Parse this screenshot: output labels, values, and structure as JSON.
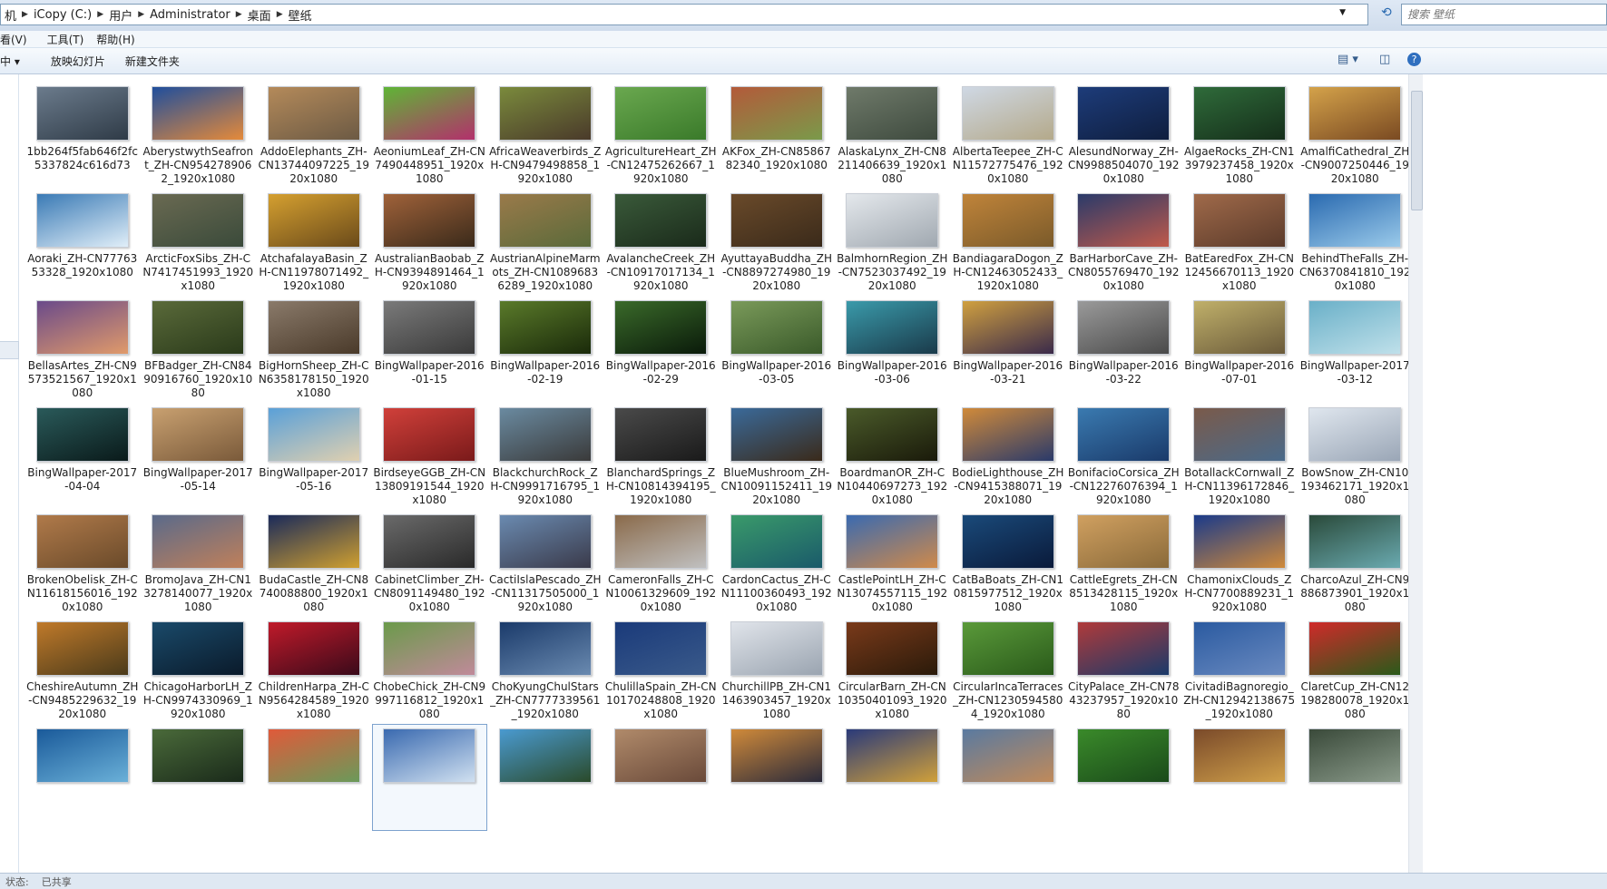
{
  "address": {
    "crumbs": [
      "机",
      "iCopy (C:)",
      "用户",
      "Administrator",
      "桌面",
      "壁纸"
    ]
  },
  "search": {
    "placeholder": "搜索 壁纸"
  },
  "menu": [
    "看(V)",
    "工具(T)",
    "帮助(H)"
  ],
  "toolbar": {
    "organize": "中 ▾",
    "slideshow": "放映幻灯片",
    "new_folder": "新建文件夹"
  },
  "status": {
    "left": "状态:",
    "right": "已共享"
  },
  "files": [
    {
      "name": "1bb264f5fab646f2fc5337824c616d73",
      "colors": [
        "#6b7b8c",
        "#2f3b47"
      ]
    },
    {
      "name": "AberystwythSeafront_ZH-CN9542789062_1920x1080",
      "colors": [
        "#1f4e9c",
        "#e58a3a"
      ]
    },
    {
      "name": "AddoElephants_ZH-CN13744097225_1920x1080",
      "colors": [
        "#b48a5a",
        "#6c5a44"
      ]
    },
    {
      "name": "AeoniumLeaf_ZH-CN7490448951_1920x1080",
      "colors": [
        "#5fb536",
        "#b3306c"
      ]
    },
    {
      "name": "AfricaWeaverbirds_ZH-CN9479498858_1920x1080",
      "colors": [
        "#7a8a3c",
        "#4a3a2a"
      ]
    },
    {
      "name": "AgricultureHeart_ZH-CN12475262667_1920x1080",
      "colors": [
        "#6aa84f",
        "#3a7a2a"
      ]
    },
    {
      "name": "AKFox_ZH-CN8586782340_1920x1080",
      "colors": [
        "#b35a3a",
        "#7a9a4a"
      ]
    },
    {
      "name": "AlaskaLynx_ZH-CN8211406639_1920x1080",
      "colors": [
        "#6f7a6a",
        "#3e4a3e"
      ]
    },
    {
      "name": "AlbertaTeepee_ZH-CN11572775476_1920x1080",
      "colors": [
        "#cfd8e4",
        "#b4a98a"
      ]
    },
    {
      "name": "AlesundNorway_ZH-CN9988504070_1920x1080",
      "colors": [
        "#1d3c7a",
        "#0f1e3e"
      ]
    },
    {
      "name": "AlgaeRocks_ZH-CN13979237458_1920x1080",
      "colors": [
        "#2f6b3a",
        "#152e1a"
      ]
    },
    {
      "name": "AmalfiCathedral_ZH-CN9007250446_1920x1080",
      "colors": [
        "#d4a24a",
        "#7a4a22"
      ]
    },
    {
      "name": "Aoraki_ZH-CN7776353328_1920x1080",
      "colors": [
        "#3a7ab5",
        "#e0eef8"
      ]
    },
    {
      "name": "ArcticFoxSibs_ZH-CN7417451993_1920x1080",
      "colors": [
        "#6a6a52",
        "#3a4a3a"
      ]
    },
    {
      "name": "AtchafalayaBasin_ZH-CN11978071492_1920x1080",
      "colors": [
        "#d5a030",
        "#6a4a1a"
      ]
    },
    {
      "name": "AustralianBaobab_ZH-CN9394891464_1920x1080",
      "colors": [
        "#a0623a",
        "#3a2a1a"
      ]
    },
    {
      "name": "AustrianAlpineMarmots_ZH-CN10896836289_1920x1080",
      "colors": [
        "#9a7a4a",
        "#5a6a3a"
      ]
    },
    {
      "name": "AvalancheCreek_ZH-CN10917017134_1920x1080",
      "colors": [
        "#3a5a3a",
        "#1a2a1a"
      ]
    },
    {
      "name": "AyuttayaBuddha_ZH-CN8897274980_1920x1080",
      "colors": [
        "#6a4a2a",
        "#3a2a1a"
      ]
    },
    {
      "name": "BalmhornRegion_ZH-CN7523037492_1920x1080",
      "colors": [
        "#e4e8ec",
        "#a0a8b0"
      ]
    },
    {
      "name": "BandiagaraDogon_ZH-CN12463052433_1920x1080",
      "colors": [
        "#c0843a",
        "#7a5a2a"
      ]
    },
    {
      "name": "BarHarborCave_ZH-CN8055769470_1920x1080",
      "colors": [
        "#2a3a6a",
        "#c05a4a"
      ]
    },
    {
      "name": "BatEaredFox_ZH-CN12456670113_1920x1080",
      "colors": [
        "#a06a4a",
        "#5a3a2a"
      ]
    },
    {
      "name": "BehindTheFalls_ZH-CN6370841810_1920x1080",
      "colors": [
        "#2a6ab0",
        "#9acaea"
      ]
    },
    {
      "name": "BellasArtes_ZH-CN9573521567_1920x1080",
      "colors": [
        "#6a4a8a",
        "#e09a6a"
      ]
    },
    {
      "name": "BFBadger_ZH-CN8490916760_1920x1080",
      "colors": [
        "#5a6a3a",
        "#2a3a1a"
      ]
    },
    {
      "name": "BigHornSheep_ZH-CN6358178150_1920x1080",
      "colors": [
        "#8a7a6a",
        "#4a3a2a"
      ]
    },
    {
      "name": "BingWallpaper-2016-01-15",
      "colors": [
        "#7a7a7a",
        "#3a3a3a"
      ]
    },
    {
      "name": "BingWallpaper-2016-02-19",
      "colors": [
        "#5a7a2a",
        "#1a2a0a"
      ]
    },
    {
      "name": "BingWallpaper-2016-02-29",
      "colors": [
        "#3a6a2a",
        "#0a1a0a"
      ]
    },
    {
      "name": "BingWallpaper-2016-03-05",
      "colors": [
        "#7a9a5a",
        "#3a5a2a"
      ]
    },
    {
      "name": "BingWallpaper-2016-03-06",
      "colors": [
        "#3a9aaa",
        "#1a3a4a"
      ]
    },
    {
      "name": "BingWallpaper-2016-03-21",
      "colors": [
        "#d0a040",
        "#3a2a4a"
      ]
    },
    {
      "name": "BingWallpaper-2016-03-22",
      "colors": [
        "#9a9a9a",
        "#4a4a4a"
      ]
    },
    {
      "name": "BingWallpaper-2016-07-01",
      "colors": [
        "#c0b06a",
        "#6a5a3a"
      ]
    },
    {
      "name": "BingWallpaper-2017-03-12",
      "colors": [
        "#6ab0c8",
        "#bfe0ea"
      ]
    },
    {
      "name": "BingWallpaper-2017-04-04",
      "colors": [
        "#2a5a5a",
        "#0a1a1a"
      ]
    },
    {
      "name": "BingWallpaper-2017-05-14",
      "colors": [
        "#c8a070",
        "#7a5a3a"
      ]
    },
    {
      "name": "BingWallpaper-2017-05-16",
      "colors": [
        "#5aa0d8",
        "#e0d0b0"
      ]
    },
    {
      "name": "BirdseyeGGB_ZH-CN13809191544_1920x1080",
      "colors": [
        "#d0403a",
        "#7a1a1a"
      ]
    },
    {
      "name": "BlackchurchRock_ZH-CN9991716795_1920x1080",
      "colors": [
        "#6a8aa0",
        "#3a3a3a"
      ]
    },
    {
      "name": "BlanchardSprings_ZH-CN10814394195_1920x1080",
      "colors": [
        "#4a4a4a",
        "#1a1a1a"
      ]
    },
    {
      "name": "BlueMushroom_ZH-CN10091152411_1920x1080",
      "colors": [
        "#3a6a9a",
        "#3a2a1a"
      ]
    },
    {
      "name": "BoardmanOR_ZH-CN10440697273_1920x1080",
      "colors": [
        "#4a5a2a",
        "#1a1a0a"
      ]
    },
    {
      "name": "BodieLighthouse_ZH-CN9415388071_1920x1080",
      "colors": [
        "#d08a3a",
        "#2a3a6a"
      ]
    },
    {
      "name": "BonifacioCorsica_ZH-CN12276076394_1920x1080",
      "colors": [
        "#3a7ab0",
        "#1a3a6a"
      ]
    },
    {
      "name": "BotallackCornwall_ZH-CN11396172846_1920x1080",
      "colors": [
        "#7a5a4a",
        "#4a6a8a"
      ]
    },
    {
      "name": "BowSnow_ZH-CN10193462171_1920x1080",
      "colors": [
        "#dfe6ee",
        "#9aa6b6"
      ]
    },
    {
      "name": "BrokenObelisk_ZH-CN11618156016_1920x1080",
      "colors": [
        "#b07a4a",
        "#6a4a2a"
      ]
    },
    {
      "name": "BromoJava_ZH-CN13278140077_1920x1080",
      "colors": [
        "#5a6a8a",
        "#c0805a"
      ]
    },
    {
      "name": "BudaCastle_ZH-CN8740088800_1920x1080",
      "colors": [
        "#1a2a5a",
        "#d0a030"
      ]
    },
    {
      "name": "CabinetClimber_ZH-CN8091149480_1920x1080",
      "colors": [
        "#6a6a6a",
        "#2a2a2a"
      ]
    },
    {
      "name": "CactiIslaPescado_ZH-CN11317505000_1920x1080",
      "colors": [
        "#6a8ab0",
        "#3a3a4a"
      ]
    },
    {
      "name": "CameronFalls_ZH-CN10061329609_1920x1080",
      "colors": [
        "#8a6a4a",
        "#c0c0c0"
      ]
    },
    {
      "name": "CardonCactus_ZH-CN11100360493_1920x1080",
      "colors": [
        "#3a9a6a",
        "#1a5a6a"
      ]
    },
    {
      "name": "CastlePointLH_ZH-CN13074557115_1920x1080",
      "colors": [
        "#3a6ab0",
        "#d08a4a"
      ]
    },
    {
      "name": "CatBaBoats_ZH-CN10815977512_1920x1080",
      "colors": [
        "#1a4a7a",
        "#0a1a3a"
      ]
    },
    {
      "name": "CattleEgrets_ZH-CN8513428115_1920x1080",
      "colors": [
        "#d0a060",
        "#8a6a3a"
      ]
    },
    {
      "name": "ChamonixClouds_ZH-CN7700889231_1920x1080",
      "colors": [
        "#1a3a8a",
        "#d08a3a"
      ]
    },
    {
      "name": "CharcoAzul_ZH-CN9886873901_1920x1080",
      "colors": [
        "#2a4a3a",
        "#6aaab0"
      ]
    },
    {
      "name": "CheshireAutumn_ZH-CN9485229632_1920x1080",
      "colors": [
        "#c07a2a",
        "#4a3a1a"
      ]
    },
    {
      "name": "ChicagoHarborLH_ZH-CN9974330969_1920x1080",
      "colors": [
        "#1a4a6a",
        "#0a1a2a"
      ]
    },
    {
      "name": "ChildrenHarpa_ZH-CN9564284589_1920x1080",
      "colors": [
        "#c01a2a",
        "#3a0a1a"
      ]
    },
    {
      "name": "ChobeChick_ZH-CN9997116812_1920x1080",
      "colors": [
        "#6a9a4a",
        "#c08a9a"
      ]
    },
    {
      "name": "ChoKyungChulStars_ZH-CN7777339561_1920x1080",
      "colors": [
        "#1a3a6a",
        "#6a8ab0"
      ]
    },
    {
      "name": "ChulillaSpain_ZH-CN10170248808_1920x1080",
      "colors": [
        "#1a3a7a",
        "#3a5a8a"
      ]
    },
    {
      "name": "ChurchillPB_ZH-CN11463903457_1920x1080",
      "colors": [
        "#e0e4ea",
        "#9aa4b0"
      ]
    },
    {
      "name": "CircularBarn_ZH-CN10350401093_1920x1080",
      "colors": [
        "#7a3a1a",
        "#2a1a0a"
      ]
    },
    {
      "name": "CircularIncaTerraces_ZH-CN12305945804_1920x1080",
      "colors": [
        "#5a9a3a",
        "#2a5a1a"
      ]
    },
    {
      "name": "CityPalace_ZH-CN7843237957_1920x1080",
      "colors": [
        "#b03a3a",
        "#1a3a6a"
      ]
    },
    {
      "name": "CivitadiBagnoregio_ZH-CN12942138675_1920x1080",
      "colors": [
        "#2a5aa0",
        "#6a8ac0"
      ]
    },
    {
      "name": "ClaretCup_ZH-CN12198280078_1920x1080",
      "colors": [
        "#d02a2a",
        "#2a5a1a"
      ]
    },
    {
      "name": "",
      "colors": [
        "#1a5a9a",
        "#6ab0d8"
      ]
    },
    {
      "name": "",
      "colors": [
        "#4a6a3a",
        "#1a2a1a"
      ]
    },
    {
      "name": "",
      "colors": [
        "#e05a3a",
        "#6a9a5a"
      ]
    },
    {
      "name": "",
      "colors": [
        "#3a6ab0",
        "#d0e0f0"
      ]
    },
    {
      "name": "",
      "colors": [
        "#4a9ad0",
        "#2a4a2a"
      ]
    },
    {
      "name": "",
      "colors": [
        "#b08a6a",
        "#6a4a3a"
      ]
    },
    {
      "name": "",
      "colors": [
        "#d08a3a",
        "#2a2a3a"
      ]
    },
    {
      "name": "",
      "colors": [
        "#2a3a7a",
        "#d0a03a"
      ]
    },
    {
      "name": "",
      "colors": [
        "#5a7aa0",
        "#c08a5a"
      ]
    },
    {
      "name": "",
      "colors": [
        "#3a8a2a",
        "#1a4a1a"
      ]
    },
    {
      "name": "",
      "colors": [
        "#7a4a2a",
        "#d0a04a"
      ]
    },
    {
      "name": "",
      "colors": [
        "#3a4a3a",
        "#8a9a8a"
      ]
    }
  ]
}
